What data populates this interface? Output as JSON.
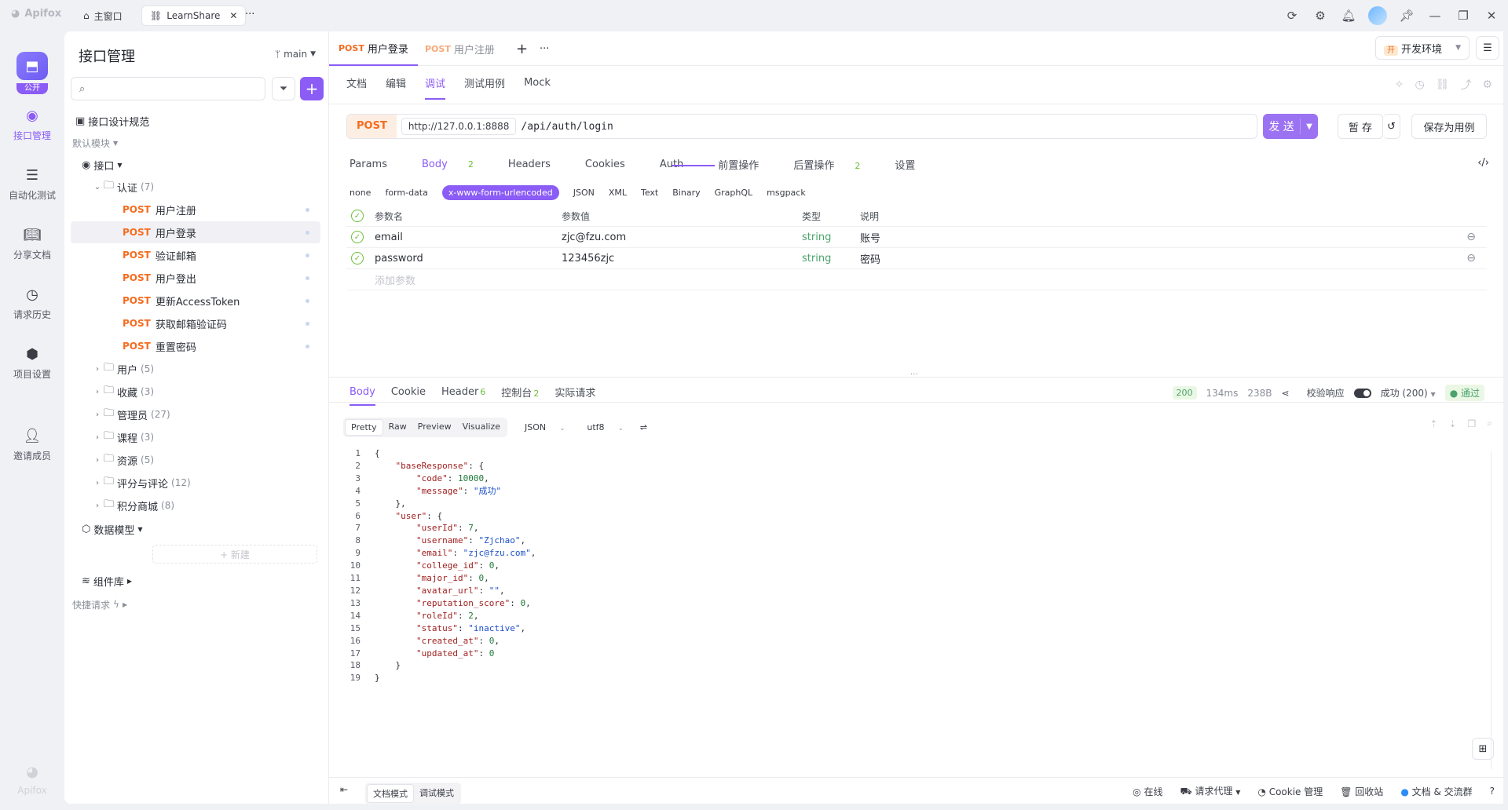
{
  "titlebar": {
    "app_name": "Apifox",
    "home_tab": "主窗口",
    "project_tab": "LearnShare",
    "more": "···"
  },
  "rail": {
    "project_badge": "公开",
    "items": [
      {
        "label": "接口管理",
        "icon": "api-icon"
      },
      {
        "label": "自动化测试",
        "icon": "automation-icon"
      },
      {
        "label": "分享文档",
        "icon": "book-icon"
      },
      {
        "label": "请求历史",
        "icon": "clock-icon"
      },
      {
        "label": "项目设置",
        "icon": "settings-icon"
      },
      {
        "label": "邀请成员",
        "icon": "add-user-icon"
      }
    ],
    "footer": "Apifox"
  },
  "sidebar": {
    "title": "接口管理",
    "branch": "main",
    "search_placeholder": "",
    "design_spec": "接口设计规范",
    "default_module": "默认模块",
    "interfaces": "接口",
    "auth_folder": {
      "name": "认证",
      "count": "(7)"
    },
    "auth_items": [
      {
        "method": "POST",
        "name": "用户注册"
      },
      {
        "method": "POST",
        "name": "用户登录"
      },
      {
        "method": "POST",
        "name": "验证邮箱"
      },
      {
        "method": "POST",
        "name": "用户登出"
      },
      {
        "method": "POST",
        "name": "更新AccessToken"
      },
      {
        "method": "POST",
        "name": "获取邮箱验证码"
      },
      {
        "method": "POST",
        "name": "重置密码"
      }
    ],
    "folders": [
      {
        "name": "用户",
        "count": "(5)"
      },
      {
        "name": "收藏",
        "count": "(3)"
      },
      {
        "name": "管理员",
        "count": "(27)"
      },
      {
        "name": "课程",
        "count": "(3)"
      },
      {
        "name": "资源",
        "count": "(5)"
      },
      {
        "name": "评分与评论",
        "count": "(12)"
      },
      {
        "name": "积分商城",
        "count": "(8)"
      }
    ],
    "data_model": "数据模型",
    "new_label": "+ 新建",
    "component_lib": "组件库",
    "quick_request": "快捷请求"
  },
  "main": {
    "tabs": [
      {
        "method": "POST",
        "name": "用户登录"
      },
      {
        "method": "POST",
        "name": "用户注册"
      }
    ],
    "env": {
      "tag": "开",
      "name": "开发环境"
    },
    "subtabs": [
      "文档",
      "编辑",
      "调试",
      "测试用例",
      "Mock"
    ],
    "url": {
      "method": "POST",
      "base": "http://127.0.0.1:8888",
      "path": "/api/auth/login"
    },
    "send": "发 送",
    "save_draft": "暂 存",
    "save_case": "保存为用例",
    "param_tabs": [
      {
        "label": "Params",
        "badge": ""
      },
      {
        "label": "Body",
        "badge": "2"
      },
      {
        "label": "Headers",
        "badge": ""
      },
      {
        "label": "Cookies",
        "badge": ""
      },
      {
        "label": "Auth",
        "badge": ""
      },
      {
        "label": "前置操作",
        "badge": ""
      },
      {
        "label": "后置操作",
        "badge": "2"
      },
      {
        "label": "设置",
        "badge": ""
      }
    ],
    "body_types": [
      "none",
      "form-data",
      "x-www-form-urlencoded",
      "JSON",
      "XML",
      "Text",
      "Binary",
      "GraphQL",
      "msgpack"
    ],
    "table_headers": {
      "name": "参数名",
      "value": "参数值",
      "type": "类型",
      "desc": "说明"
    },
    "params": [
      {
        "name": "email",
        "value": "zjc@fzu.com",
        "type": "string",
        "desc": "账号"
      },
      {
        "name": "password",
        "value": "123456zjc",
        "type": "string",
        "desc": "密码"
      }
    ],
    "add_param": "添加参数"
  },
  "response": {
    "tabs": [
      {
        "label": "Body",
        "badge": ""
      },
      {
        "label": "Cookie",
        "badge": ""
      },
      {
        "label": "Header",
        "badge": "6"
      },
      {
        "label": "控制台",
        "badge": "2"
      },
      {
        "label": "实际请求",
        "badge": ""
      }
    ],
    "status": "200",
    "time": "134ms",
    "size": "238B",
    "validate": "校验响应",
    "result": "成功 (200)",
    "pass": "通过",
    "formats": [
      "Pretty",
      "Raw",
      "Preview",
      "Visualize"
    ],
    "lang": "JSON",
    "encoding": "utf8",
    "code_lines": [
      [
        [
          "p",
          "{"
        ]
      ],
      [
        [
          "p",
          "    "
        ],
        [
          "k",
          "\"baseResponse\""
        ],
        [
          "p",
          ": {"
        ]
      ],
      [
        [
          "p",
          "        "
        ],
        [
          "k",
          "\"code\""
        ],
        [
          "p",
          ": "
        ],
        [
          "n",
          "10000"
        ],
        [
          "p",
          ","
        ]
      ],
      [
        [
          "p",
          "        "
        ],
        [
          "k",
          "\"message\""
        ],
        [
          "p",
          ": "
        ],
        [
          "s",
          "\"成功\""
        ]
      ],
      [
        [
          "p",
          "    },"
        ]
      ],
      [
        [
          "p",
          "    "
        ],
        [
          "k",
          "\"user\""
        ],
        [
          "p",
          ": {"
        ]
      ],
      [
        [
          "p",
          "        "
        ],
        [
          "k",
          "\"userId\""
        ],
        [
          "p",
          ": "
        ],
        [
          "n",
          "7"
        ],
        [
          "p",
          ","
        ]
      ],
      [
        [
          "p",
          "        "
        ],
        [
          "k",
          "\"username\""
        ],
        [
          "p",
          ": "
        ],
        [
          "s",
          "\"Zjchao\""
        ],
        [
          "p",
          ","
        ]
      ],
      [
        [
          "p",
          "        "
        ],
        [
          "k",
          "\"email\""
        ],
        [
          "p",
          ": "
        ],
        [
          "s",
          "\"zjc@fzu.com\""
        ],
        [
          "p",
          ","
        ]
      ],
      [
        [
          "p",
          "        "
        ],
        [
          "k",
          "\"college_id\""
        ],
        [
          "p",
          ": "
        ],
        [
          "n",
          "0"
        ],
        [
          "p",
          ","
        ]
      ],
      [
        [
          "p",
          "        "
        ],
        [
          "k",
          "\"major_id\""
        ],
        [
          "p",
          ": "
        ],
        [
          "n",
          "0"
        ],
        [
          "p",
          ","
        ]
      ],
      [
        [
          "p",
          "        "
        ],
        [
          "k",
          "\"avatar_url\""
        ],
        [
          "p",
          ": "
        ],
        [
          "s",
          "\"\""
        ],
        [
          "p",
          ","
        ]
      ],
      [
        [
          "p",
          "        "
        ],
        [
          "k",
          "\"reputation_score\""
        ],
        [
          "p",
          ": "
        ],
        [
          "n",
          "0"
        ],
        [
          "p",
          ","
        ]
      ],
      [
        [
          "p",
          "        "
        ],
        [
          "k",
          "\"roleId\""
        ],
        [
          "p",
          ": "
        ],
        [
          "n",
          "2"
        ],
        [
          "p",
          ","
        ]
      ],
      [
        [
          "p",
          "        "
        ],
        [
          "k",
          "\"status\""
        ],
        [
          "p",
          ": "
        ],
        [
          "s",
          "\"inactive\""
        ],
        [
          "p",
          ","
        ]
      ],
      [
        [
          "p",
          "        "
        ],
        [
          "k",
          "\"created_at\""
        ],
        [
          "p",
          ": "
        ],
        [
          "n",
          "0"
        ],
        [
          "p",
          ","
        ]
      ],
      [
        [
          "p",
          "        "
        ],
        [
          "k",
          "\"updated_at\""
        ],
        [
          "p",
          ": "
        ],
        [
          "n",
          "0"
        ]
      ],
      [
        [
          "p",
          "    }"
        ]
      ],
      [
        [
          "p",
          "}"
        ]
      ]
    ]
  },
  "statusbar": {
    "doc_mode": "文档模式",
    "debug_mode": "调试模式",
    "online": "在线",
    "proxy": "请求代理",
    "cookie": "Cookie 管理",
    "recycle": "回收站",
    "community": "文档 & 交流群"
  },
  "colors": {
    "accent": "#8b5cf6",
    "post": "#f56c1f",
    "success": "#4aa36b"
  }
}
